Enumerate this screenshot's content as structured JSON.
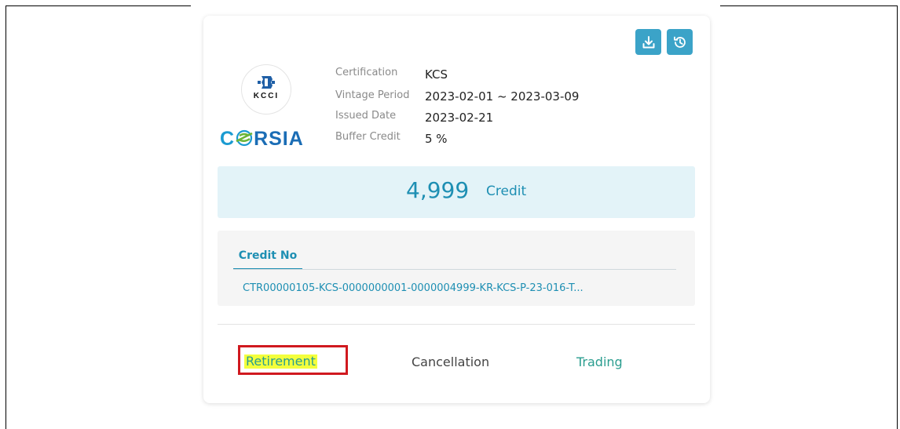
{
  "card": {
    "header_actions": {
      "download_icon": "download-icon",
      "history_icon": "history-icon",
      "accent": "#3ba3c8"
    },
    "logo": {
      "issuer_text": "KCCI",
      "scheme_text": "CORSIA"
    },
    "details": [
      {
        "label": "Certification",
        "value": "KCS"
      },
      {
        "label": "Vintage Period",
        "value": "2023-02-01 ~ 2023-03-09"
      },
      {
        "label": "Issued Date",
        "value": "2023-02-21"
      },
      {
        "label": "Buffer Credit",
        "value": "5 %"
      }
    ],
    "credit": {
      "amount": "4,999",
      "unit": "Credit",
      "color": "#1e8fb3"
    },
    "credit_no": {
      "tab_label": "Credit No",
      "value": "CTR00000105-KCS-0000000001-0000004999-KR-KCS-P-23-016-T..."
    },
    "actions": {
      "retirement": "Retirement",
      "cancellation": "Cancellation",
      "trading": "Trading"
    },
    "colors": {
      "highlight": "#f3ff3c",
      "annotation_box": "#d0191f",
      "action_teal": "#2a9d8f"
    }
  }
}
